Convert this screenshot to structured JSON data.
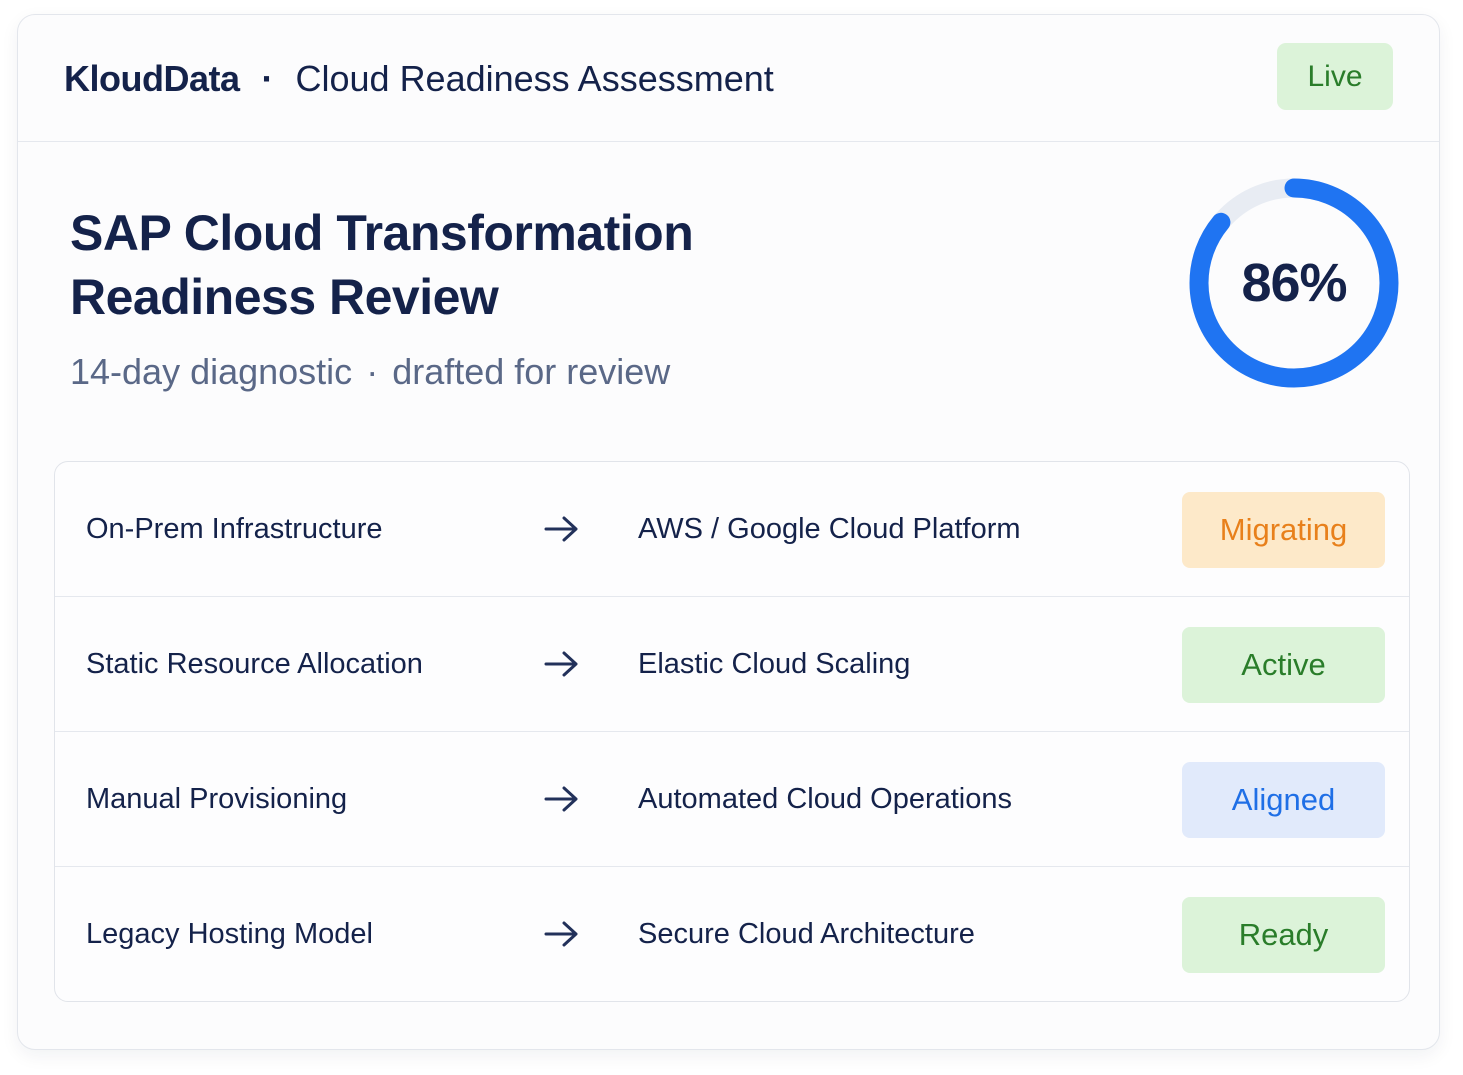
{
  "header": {
    "brand": "KloudData",
    "separator": "·",
    "product": "Cloud Readiness Assessment",
    "live_badge": "Live"
  },
  "main": {
    "title_line1": "SAP Cloud Transformation",
    "title_line2": "Readiness Review",
    "subtitle_part1": "14-day diagnostic",
    "subtitle_separator": "·",
    "subtitle_part2": "drafted for review"
  },
  "score": {
    "label": "86%",
    "percent": 86,
    "ring_color": "#1f74f2",
    "track_color": "#e8ecf3"
  },
  "transitions": [
    {
      "from": "On-Prem Infrastructure",
      "to": "AWS / Google Cloud Platform",
      "status": "Migrating",
      "status_key": "migrating"
    },
    {
      "from": "Static Resource Allocation",
      "to": "Elastic Cloud Scaling",
      "status": "Active",
      "status_key": "active"
    },
    {
      "from": "Manual Provisioning",
      "to": "Automated Cloud Operations",
      "status": "Aligned",
      "status_key": "aligned"
    },
    {
      "from": "Legacy Hosting Model",
      "to": "Secure Cloud Architecture",
      "status": "Ready",
      "status_key": "ready"
    }
  ],
  "icons": {
    "arrow": "arrow-right-icon"
  },
  "colors": {
    "text_primary": "#14224a",
    "text_secondary": "#5a6887",
    "migrating": "#e8801b",
    "active": "#2a7d2a",
    "aligned": "#1f6fe6",
    "ready": "#2a7d2a"
  }
}
